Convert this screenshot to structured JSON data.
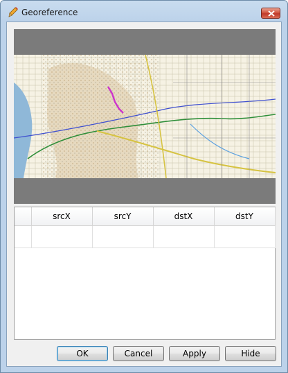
{
  "window": {
    "title": "Georeference"
  },
  "gcp_table": {
    "columns": [
      "",
      "srcX",
      "srcY",
      "dstX",
      "dstY"
    ],
    "rows": [
      [
        "",
        "",
        "",
        "",
        ""
      ]
    ]
  },
  "buttons": {
    "ok": "OK",
    "cancel": "Cancel",
    "apply": "Apply",
    "hide": "Hide"
  },
  "icons": {
    "title_icon": "pencil-icon",
    "close": "close-icon"
  },
  "colors": {
    "map_background_panel": "#7b7b7b",
    "close_button": "#c0392b",
    "route_line": "#cc33cc"
  }
}
